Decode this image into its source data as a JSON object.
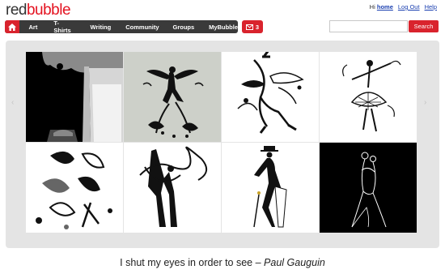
{
  "logo": {
    "part1": "red",
    "part2": "bubble"
  },
  "userlinks": {
    "greeting": "Hi",
    "home": "home",
    "logout": "Log Out",
    "help": "Help"
  },
  "nav": {
    "items": [
      "Art",
      "T-Shirts",
      "Writing",
      "Community",
      "Groups",
      "MyBubble"
    ],
    "mail_count": "3"
  },
  "search": {
    "placeholder": "",
    "button_label": "Search"
  },
  "gallery": {
    "tiles": [
      {
        "subject": "dancer-silhouette-under-tree",
        "background": "black"
      },
      {
        "subject": "ornate-fairy-silhouette",
        "background": "gray"
      },
      {
        "subject": "flourish-ballet-dancer",
        "background": "white"
      },
      {
        "subject": "swirl-ballerina",
        "background": "white"
      },
      {
        "subject": "abstract-floral-dancers",
        "background": "white"
      },
      {
        "subject": "ribbon-gymnasts",
        "background": "white"
      },
      {
        "subject": "top-hat-dancer-with-cane",
        "background": "white"
      },
      {
        "subject": "line-art-tango-couple",
        "background": "black"
      }
    ]
  },
  "caption": {
    "quote": "I shut my eyes in order to see – ",
    "author": "Paul Gauguin"
  },
  "colors": {
    "brand_red": "#d9232d",
    "nav_dark": "#3a3a3a",
    "gallery_bg": "#e4e4e4",
    "link_blue": "#1a3fb0"
  }
}
